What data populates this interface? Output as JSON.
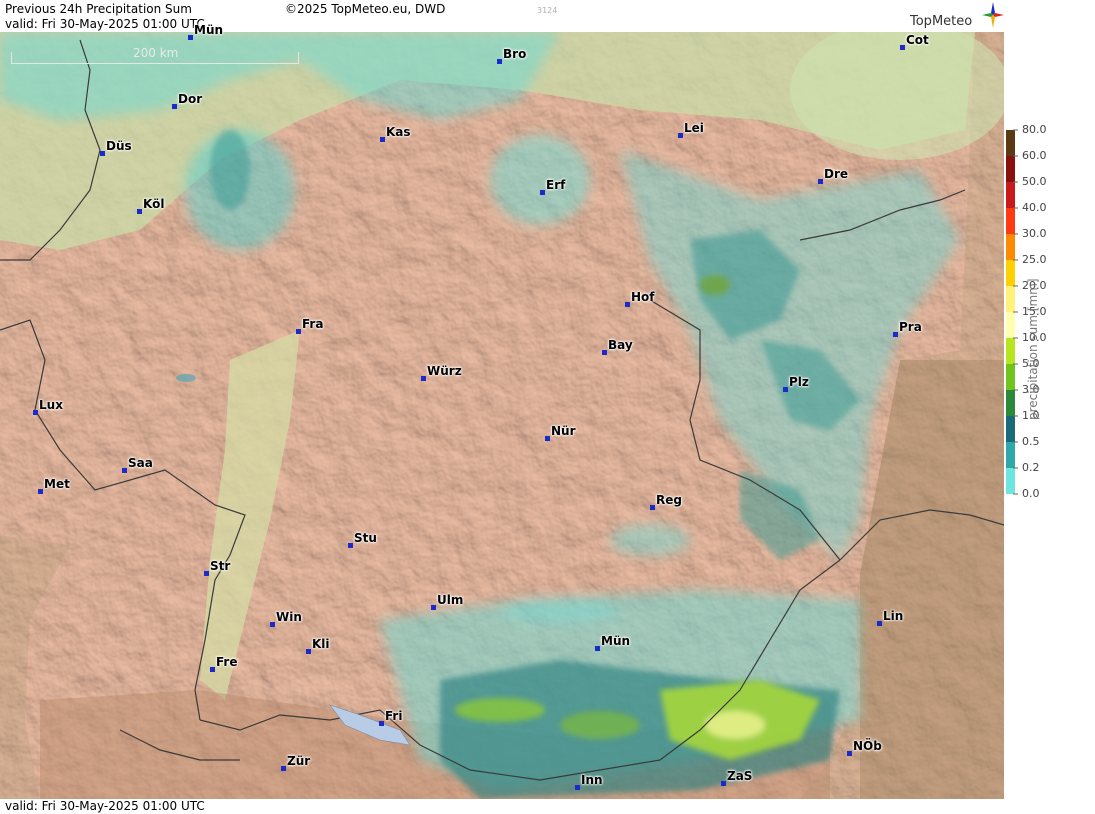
{
  "header": {
    "title": "Previous 24h Precipitation Sum",
    "copyright": "©2025 TopMeteo.eu, DWD",
    "run_code": "3124",
    "valid": "valid:  Fri  30-May-2025 01:00 UTC",
    "logo_text": "TopMeteo"
  },
  "footer": {
    "valid": "valid:  Fri  30-May-2025 01:00 UTC"
  },
  "map": {
    "scale_label": "200 km"
  },
  "cities": [
    {
      "name": "Mün"
    },
    {
      "name": "Bro"
    },
    {
      "name": "Cot"
    },
    {
      "name": "Dor"
    },
    {
      "name": "Kas"
    },
    {
      "name": "Lei"
    },
    {
      "name": "Düs"
    },
    {
      "name": "Erf"
    },
    {
      "name": "Dre"
    },
    {
      "name": "Köl"
    },
    {
      "name": "Hof"
    },
    {
      "name": "Fra"
    },
    {
      "name": "Pra"
    },
    {
      "name": "Bay"
    },
    {
      "name": "Würz"
    },
    {
      "name": "Plz"
    },
    {
      "name": "Lux"
    },
    {
      "name": "Nür"
    },
    {
      "name": "Saa"
    },
    {
      "name": "Met"
    },
    {
      "name": "Reg"
    },
    {
      "name": "Stu"
    },
    {
      "name": "Str"
    },
    {
      "name": "Ulm"
    },
    {
      "name": "Lin"
    },
    {
      "name": "Win"
    },
    {
      "name": "Mün"
    },
    {
      "name": "Kli"
    },
    {
      "name": "Fre"
    },
    {
      "name": "Fri"
    },
    {
      "name": "NÖb"
    },
    {
      "name": "Zür"
    },
    {
      "name": "Inn"
    },
    {
      "name": "ZaS"
    }
  ],
  "legend": {
    "title": "precipitation sum [mm]",
    "classes": [
      {
        "value": "80.0",
        "color": "#5a3a12"
      },
      {
        "value": "60.0",
        "color": "#8a0f0f"
      },
      {
        "value": "50.0",
        "color": "#c81a1a"
      },
      {
        "value": "40.0",
        "color": "#ff3a12"
      },
      {
        "value": "30.0",
        "color": "#ff8a00"
      },
      {
        "value": "25.0",
        "color": "#ffd000"
      },
      {
        "value": "20.0",
        "color": "#fff27a"
      },
      {
        "value": "15.0",
        "color": "#ffffb0"
      },
      {
        "value": "10.0",
        "color": "#b6e61e"
      },
      {
        "value": "5.0",
        "color": "#6fc41e"
      },
      {
        "value": "3.0",
        "color": "#2b8a3a"
      },
      {
        "value": "1.0",
        "color": "#1a6a78"
      },
      {
        "value": "0.5",
        "color": "#2fa8a8"
      },
      {
        "value": "0.2",
        "color": "#6ee6e0"
      },
      {
        "value": "0.0",
        "color": "#d8fbf8"
      }
    ]
  }
}
